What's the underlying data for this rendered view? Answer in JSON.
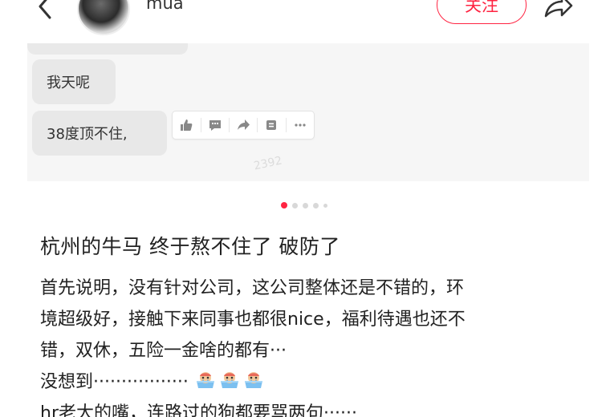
{
  "header": {
    "username": "mua",
    "follow_label": "关注"
  },
  "carousel": {
    "messages": [
      "我天呢",
      "38度顶不住,"
    ],
    "toolbar_icons": [
      "thumb-up-icon",
      "comment-icon",
      "forward-icon",
      "quote-icon",
      "more-icon"
    ],
    "watermark": "2392",
    "dots": {
      "count": 5,
      "active_index": 0
    }
  },
  "post": {
    "title": "杭州的牛马 终于熬不住了 破防了",
    "lines": [
      "首先说明，没有针对公司，这公司整体还是不错的，环",
      "境超级好，接触下来同事也都很nice，福利待遇也还不",
      "错，双休，五险一金啥的都有···",
      "没想到·················",
      "hr老大的嘴，连路过的狗都要骂两句······"
    ],
    "emoji_name": "crying-bath-emoji"
  },
  "colors": {
    "accent": "#ff2442",
    "bubble_bg": "#e8e8e8",
    "carousel_bg": "#f6f6f6"
  }
}
